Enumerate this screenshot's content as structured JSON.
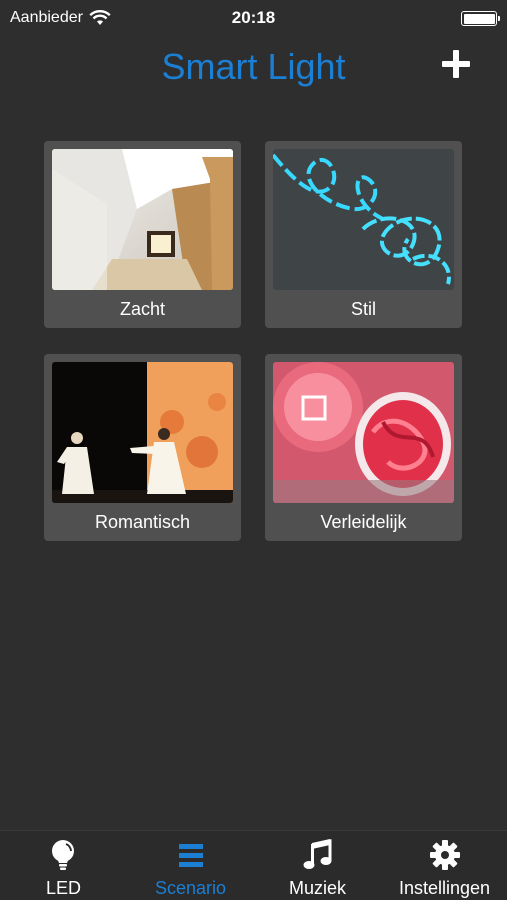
{
  "status_bar": {
    "carrier": "Aanbieder",
    "time": "20:18"
  },
  "header": {
    "title": "Smart Light",
    "add_icon": "plus-icon"
  },
  "scenarios": [
    {
      "label": "Zacht",
      "image": "staircase-photo"
    },
    {
      "label": "Stil",
      "image": "blue-el-wire-photo"
    },
    {
      "label": "Romantisch",
      "image": "stage-performers-photo"
    },
    {
      "label": "Verleidelijk",
      "image": "red-lamp-photo"
    }
  ],
  "tab_bar": {
    "active": "Scenario",
    "active_color": "#1b7fd4",
    "tabs": [
      {
        "label": "LED",
        "icon": "lightbulb-icon"
      },
      {
        "label": "Scenario",
        "icon": "list-icon"
      },
      {
        "label": "Muziek",
        "icon": "music-note-icon"
      },
      {
        "label": "Instellingen",
        "icon": "gear-icon"
      }
    ]
  },
  "colors": {
    "background": "#2e2e2e",
    "accent": "#1b7fd4",
    "tile": "#505050"
  }
}
